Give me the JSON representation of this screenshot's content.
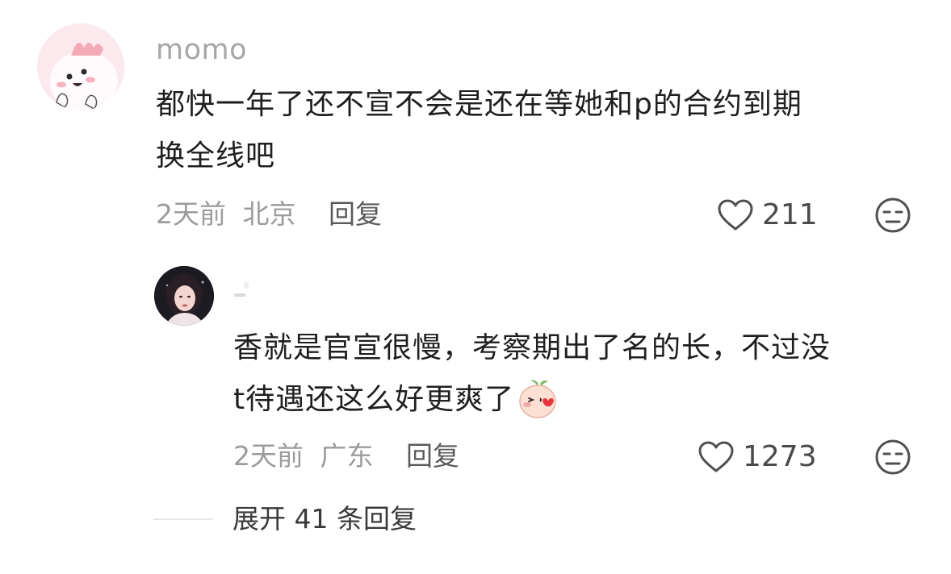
{
  "comment": {
    "username": "momo",
    "text_line1": "都快一年了还不宣不会是还在等她和p的合约到期",
    "text_line2": "换全线吧",
    "time": "2天前",
    "location": "北京",
    "reply_label": "回复",
    "likes": "211",
    "avatar_icon": "cute-pink-character-avatar",
    "like_icon": "heart-outline-icon",
    "dislike_icon": "meh-face-icon"
  },
  "reply": {
    "text_line1": "香就是官宣很慢，考察期出了名的长，不过没",
    "text_line2": "t待遇还这么好更爽了",
    "emoji": "blushing-peach-emoji",
    "time": "2天前",
    "location": "广东",
    "reply_label": "回复",
    "likes": "1273",
    "avatar_icon": "woman-portrait-avatar",
    "like_icon": "heart-outline-icon",
    "dislike_icon": "meh-face-icon"
  },
  "expand": {
    "label": "展开 41 条回复"
  },
  "colors": {
    "text_primary": "#1f1f1f",
    "text_secondary": "#9b9b9b",
    "icon": "#505050",
    "avatar_pink": "#fce9ee"
  }
}
